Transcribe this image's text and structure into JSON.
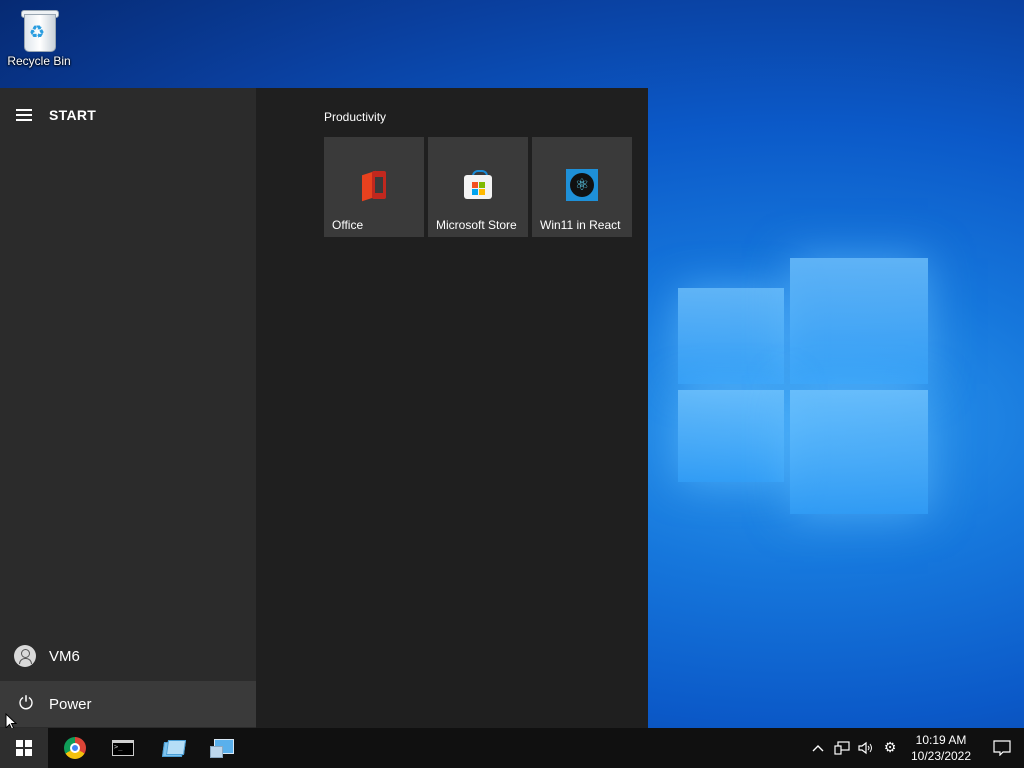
{
  "desktop": {
    "icons": [
      {
        "label": "Recycle Bin",
        "icon": "recycle-bin-icon"
      }
    ]
  },
  "start_menu": {
    "title": "START",
    "user": {
      "name": "VM6",
      "icon": "user-icon"
    },
    "power": {
      "label": "Power",
      "icon": "power-icon"
    },
    "group": {
      "title": "Productivity",
      "tiles": [
        {
          "label": "Office",
          "icon": "office-icon"
        },
        {
          "label": "Microsoft Store",
          "icon": "microsoft-store-icon"
        },
        {
          "label": "Win11 in React",
          "icon": "react-icon"
        }
      ]
    }
  },
  "taskbar": {
    "pinned": [
      {
        "name": "Start",
        "icon": "windows-logo-icon"
      },
      {
        "name": "Chrome",
        "icon": "chrome-icon"
      },
      {
        "name": "Terminal",
        "icon": "terminal-icon"
      },
      {
        "name": "File Explorer",
        "icon": "file-explorer-icon"
      },
      {
        "name": "This PC",
        "icon": "this-pc-icon"
      }
    ],
    "tray": {
      "chevron": "^",
      "time": "10:19 AM",
      "date": "10/23/2022"
    }
  },
  "colors": {
    "start_left": "#2b2b2b",
    "start_right": "#1f1f1f",
    "tile": "#3a3a3a",
    "taskbar": "#101010"
  }
}
